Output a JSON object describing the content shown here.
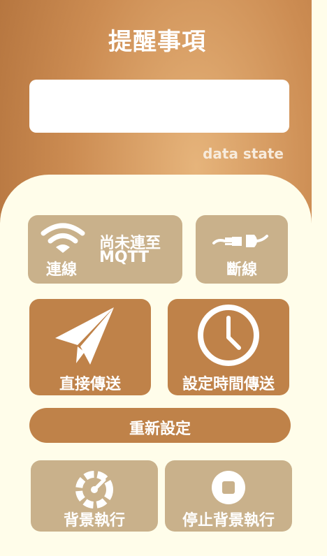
{
  "header": {
    "title": "提醒事項",
    "state_text": "data state"
  },
  "message_box": {
    "value": ""
  },
  "connect": {
    "label": "連線",
    "status_line1": "尚未連至",
    "status_line2": "MQTT",
    "icon": "wifi-icon"
  },
  "disconnect": {
    "label": "斷線",
    "icon": "plug-icon"
  },
  "send_now": {
    "label": "直接傳送",
    "icon": "paper-plane-icon"
  },
  "scheduled_send": {
    "label": "設定時間傳送",
    "icon": "clock-icon"
  },
  "reset": {
    "label": "重新設定"
  },
  "background_run": {
    "label": "背景執行",
    "icon": "gauge-icon"
  },
  "stop_background": {
    "label": "停止背景執行",
    "icon": "stop-icon"
  },
  "colors": {
    "light_button": "#c9b18b",
    "dark_button": "#bf8249",
    "panel": "#fffdea",
    "header_gradient": "#cc8c52"
  }
}
